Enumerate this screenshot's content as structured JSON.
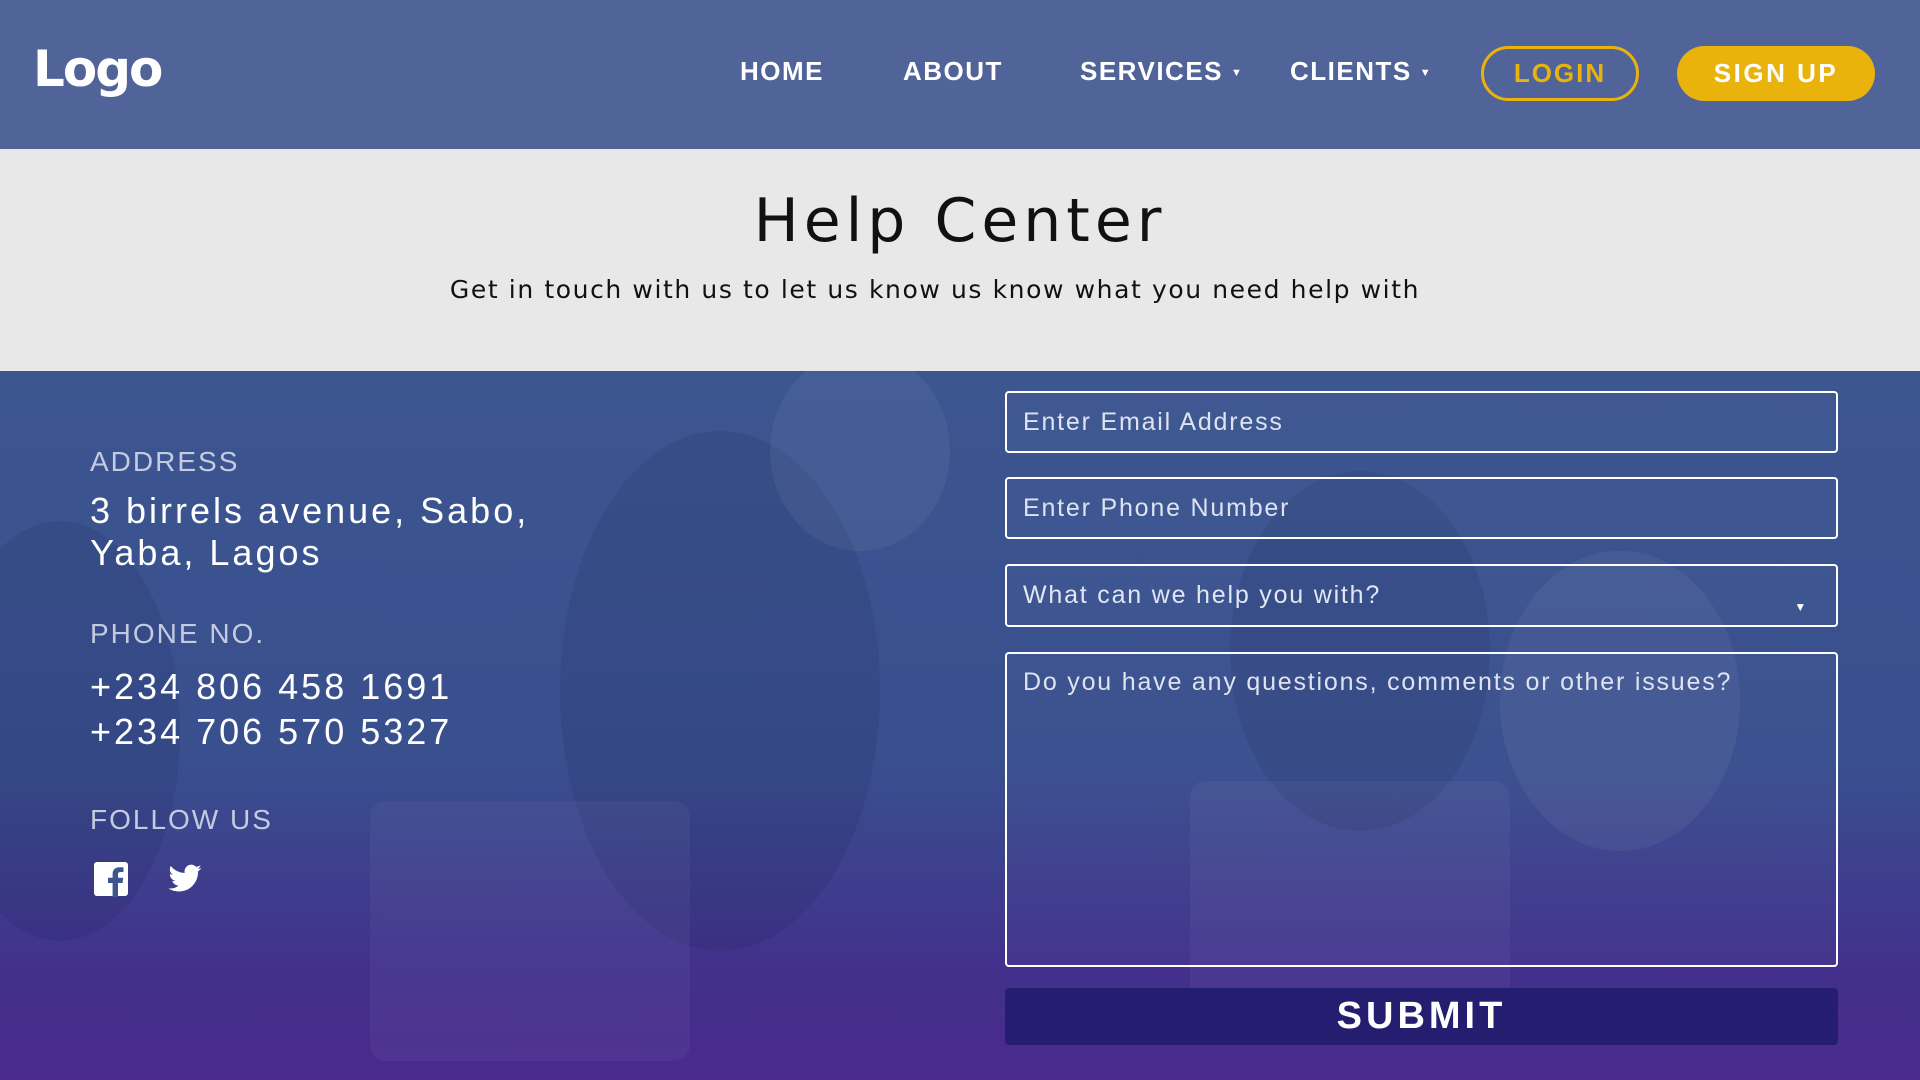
{
  "header": {
    "logo": "Logo",
    "nav": {
      "home": "HOME",
      "about": "ABOUT",
      "services": "SERVICES",
      "clients": "CLIENTS"
    },
    "login_label": "LOGIN",
    "signup_label": "SIGN UP"
  },
  "hero": {
    "title": "Help Center",
    "subtitle": "Get in touch with us to let us know us know what you need help with"
  },
  "contact": {
    "address_label": "ADDRESS",
    "address_line1": "3 birrels avenue, Sabo,",
    "address_line2": "Yaba, Lagos",
    "phone_label": "PHONE NO.",
    "phone1": "+234 806 458 1691",
    "phone2": "+234 706 570 5327",
    "follow_label": "FOLLOW US",
    "social_icons": [
      "facebook-icon",
      "twitter-icon"
    ]
  },
  "form": {
    "email_placeholder": "Enter Email Address",
    "phone_placeholder": "Enter Phone Number",
    "topic_placeholder": "What can we help you with?",
    "message_placeholder": "Do you have any questions, comments or other issues?",
    "submit_label": "SUBMIT"
  },
  "colors": {
    "header_bg": "#51649a",
    "accent_yellow": "#e9b30c",
    "hero_bg": "#e8e8e8",
    "submit_bg": "#251d70"
  }
}
